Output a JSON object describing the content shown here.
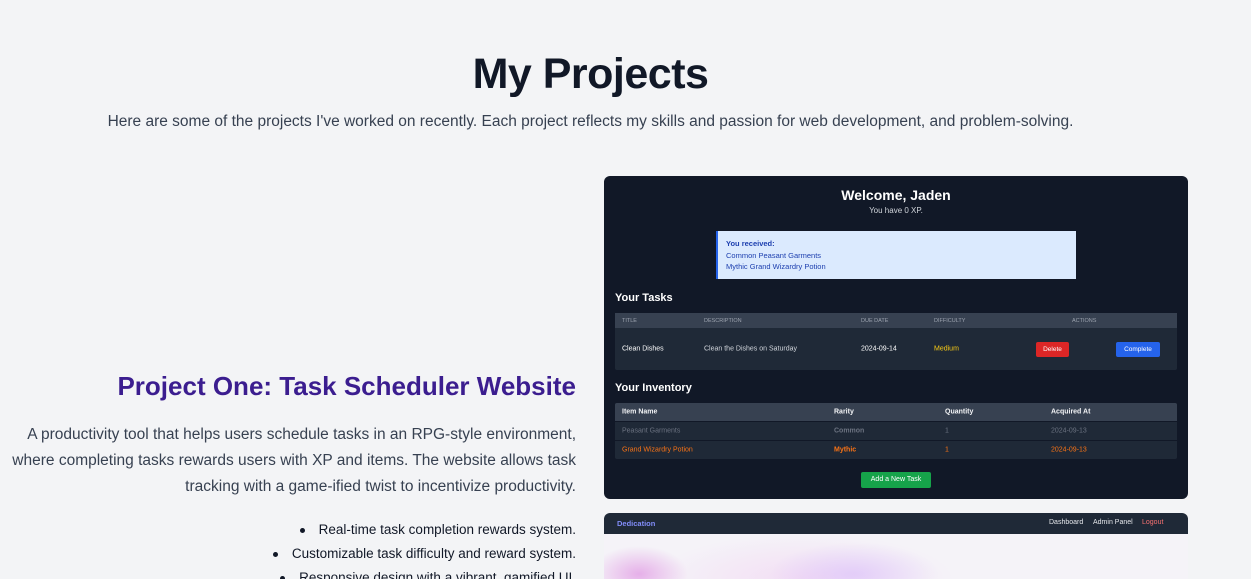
{
  "header": {
    "title": "My Projects",
    "subtitle": "Here are some of the projects I've worked on recently. Each project reflects my skills and passion for web development, and problem-solving."
  },
  "project_one": {
    "title": "Project One: Task Scheduler Website",
    "description": "A productivity tool that helps users schedule tasks in an RPG-style environment, where completing tasks rewards users with XP and items. The website allows task tracking with a game-ified twist to incentivize productivity.",
    "features": [
      "Real-time task completion rewards system.",
      "Customizable task difficulty and reward system.",
      "Responsive design with a vibrant, gamified UI."
    ]
  },
  "screenshot_one": {
    "welcome": "Welcome, Jaden",
    "xp": "You have 0 XP.",
    "reward_heading": "You received:",
    "reward_items": [
      "Common Peasant Garments",
      "Mythic Grand Wizardry Potion"
    ],
    "tasks_title": "Your Tasks",
    "task_columns": [
      "TITLE",
      "DESCRIPTION",
      "DUE DATE",
      "DIFFICULTY",
      "ACTIONS"
    ],
    "task_row": {
      "title": "Clean Dishes",
      "description": "Clean the Dishes on Saturday",
      "due_date": "2024-09-14",
      "difficulty": "Medium",
      "delete_label": "Delete",
      "complete_label": "Complete"
    },
    "inventory_title": "Your Inventory",
    "inventory_columns": [
      "Item Name",
      "Rarity",
      "Quantity",
      "Acquired At"
    ],
    "inventory_rows": [
      {
        "name": "Peasant Garments",
        "rarity": "Common",
        "quantity": "1",
        "acquired": "2024-09-13"
      },
      {
        "name": "Grand Wizardry Potion",
        "rarity": "Mythic",
        "quantity": "1",
        "acquired": "2024-09-13"
      }
    ],
    "add_task_label": "Add a New Task"
  },
  "screenshot_two": {
    "brand": "Dedication",
    "nav": {
      "dashboard": "Dashboard",
      "admin": "Admin Panel",
      "logout": "Logout"
    }
  },
  "colors": {
    "background": "#f3f4f6",
    "project_title": "#3b1d8f",
    "app_bg": "#111827",
    "delete": "#dc2626",
    "complete": "#2563eb",
    "add": "#16a34a",
    "mythic": "#f97316",
    "medium": "#facc15"
  }
}
